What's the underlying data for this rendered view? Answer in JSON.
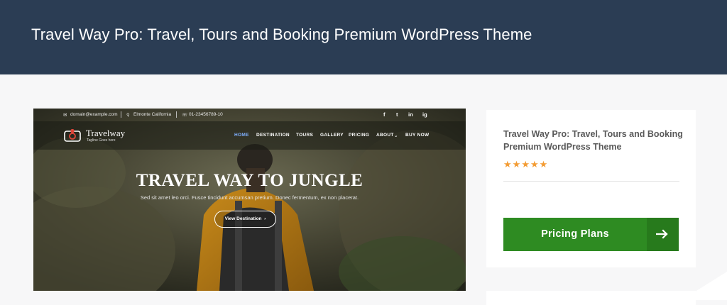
{
  "header": {
    "title": "Travel Way Pro: Travel, Tours and Booking Premium WordPress Theme"
  },
  "preview": {
    "topbar": {
      "email": "domain@example.com",
      "location": "Elmonte California",
      "phone": "01-23456789-10",
      "social": [
        "f",
        "t",
        "in",
        "ig"
      ]
    },
    "logo": {
      "name": "Travelway",
      "tagline": "Tagline Goes here"
    },
    "nav": [
      "HOME",
      "DESTINATION",
      "TOURS",
      "GALLERY",
      "PRICING",
      "ABOUT",
      "BUY NOW"
    ],
    "hero": {
      "title": "TRAVEL WAY TO JUNGLE",
      "subtitle": "Sed sit amet leo orci. Fusce tincidunt accumsan pretium. Donec fermentum, ex non placerat.",
      "button": "View Destination"
    }
  },
  "product": {
    "title": "Travel Way Pro: Travel, Tours and Booking Premium WordPress Theme",
    "rating": 5,
    "cta_label": "Pricing Plans"
  },
  "colors": {
    "header_bg": "#2b3d54",
    "cta": "#2e8b22",
    "star": "#f39c34"
  }
}
